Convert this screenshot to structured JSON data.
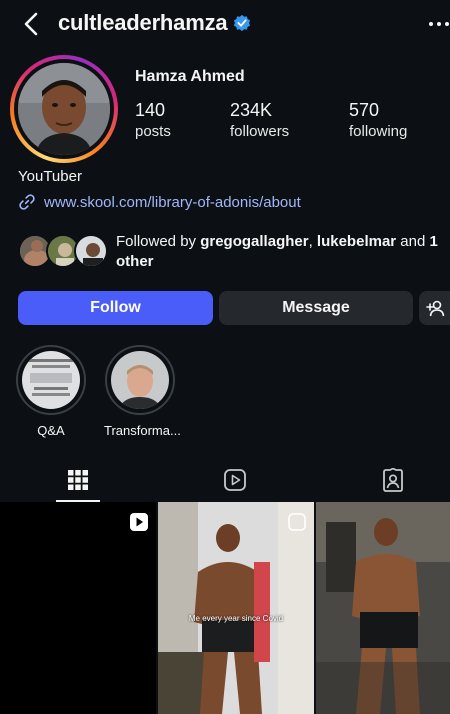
{
  "header": {
    "username": "cultleaderhamza",
    "verified": true
  },
  "profile": {
    "full_name": "Hamza Ahmed",
    "stats": [
      {
        "value": "140",
        "label": "posts"
      },
      {
        "value": "234K",
        "label": "followers"
      },
      {
        "value": "570",
        "label": "following"
      }
    ],
    "bio": "YouTuber",
    "link": "www.skool.com/library-of-adonis/about",
    "followed_by": {
      "prefix": "Followed by ",
      "user1": "gregogallagher",
      "separator": ", ",
      "user2": "lukebelmar",
      "and_text": " and ",
      "count_text": "1",
      "suffix": "other"
    }
  },
  "actions": {
    "follow_label": "Follow",
    "message_label": "Message"
  },
  "highlights": [
    {
      "label": "Q&A"
    },
    {
      "label": "Transforma..."
    }
  ],
  "tabs": [
    {
      "icon": "grid-icon",
      "active": true
    },
    {
      "icon": "reels-icon",
      "active": false
    },
    {
      "icon": "tagged-icon",
      "active": false
    }
  ],
  "posts": [
    {
      "type": "reel",
      "caption": ""
    },
    {
      "type": "reel",
      "caption": "Me every year since Covid"
    },
    {
      "type": "photo",
      "caption": ""
    }
  ],
  "colors": {
    "background": "#0c1014",
    "follow_button": "#4a5df9",
    "secondary_button": "#25292e",
    "link": "#a2b6f8",
    "verified_badge": "#3897f0"
  }
}
